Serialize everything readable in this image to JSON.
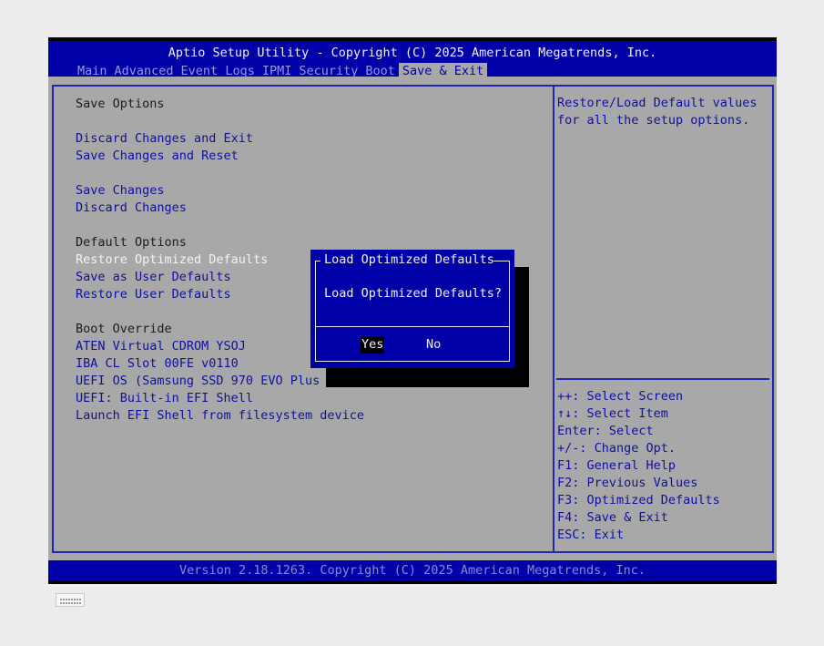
{
  "header": {
    "title": "Aptio Setup Utility - Copyright (C) 2025 American Megatrends, Inc.",
    "tabs": [
      "Main",
      "Advanced",
      "Event Logs",
      "IPMI",
      "Security",
      "Boot",
      "Save & Exit"
    ],
    "active_tab": "Save & Exit"
  },
  "menu": {
    "save_options_label": "Save Options",
    "discard_and_exit": "Discard Changes and Exit",
    "save_and_reset": "Save Changes and Reset",
    "save_changes": "Save Changes",
    "discard_changes": "Discard Changes",
    "default_options_label": "Default Options",
    "restore_optimized": "Restore Optimized Defaults",
    "save_user_defaults": "Save as User Defaults",
    "restore_user_defaults": "Restore User Defaults",
    "boot_override_label": "Boot Override",
    "boot_items": [
      "ATEN Virtual CDROM YSOJ",
      "IBA CL Slot 00FE v0110",
      "UEFI OS (Samsung SSD 970 EVO Plus 2",
      "UEFI: Built-in EFI Shell",
      "Launch EFI Shell from filesystem device"
    ]
  },
  "help": {
    "line1": "Restore/Load Default values",
    "line2": "for all the setup options."
  },
  "keys": [
    "++: Select Screen",
    "↑↓: Select Item",
    "Enter: Select",
    "+/-: Change Opt.",
    "F1: General Help",
    "F2: Previous Values",
    "F3: Optimized Defaults",
    "F4: Save & Exit",
    "ESC: Exit"
  ],
  "dialog": {
    "title": "Load Optimized Defaults",
    "message": "Load Optimized Defaults?",
    "yes": "Yes",
    "no": "No"
  },
  "footer": {
    "version": "Version 2.18.1263. Copyright (C) 2025 American Megatrends, Inc."
  },
  "colors": {
    "bios_blue": "#0000a8",
    "bios_gray": "#a8a8a8",
    "item_blue": "#1010a0"
  },
  "icons": {
    "keyboard": "keyboard-icon"
  }
}
